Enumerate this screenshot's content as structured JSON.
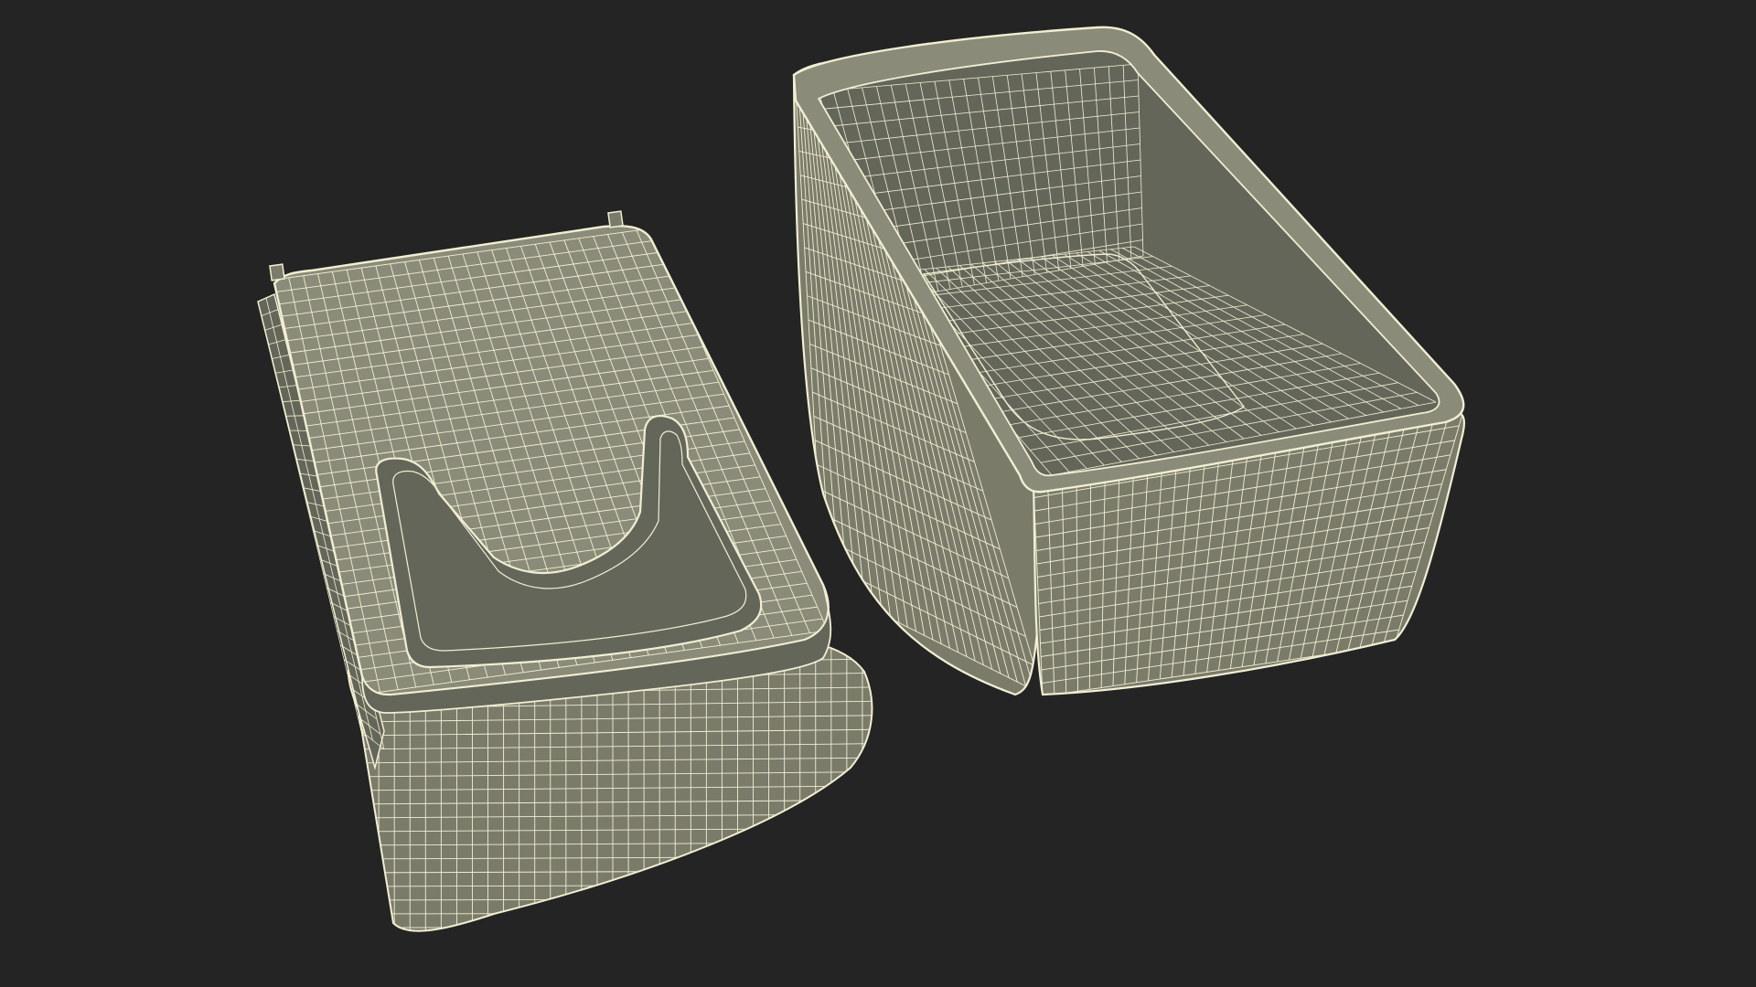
{
  "scene": {
    "background_color": "#242424",
    "surface_color": "#7b7b6a",
    "surface_shade_color": "#65665a",
    "surface_light_color": "#8a8b78",
    "wire_color": "#f1eed3",
    "objects": [
      {
        "name": "lid",
        "description_icon": "wireframe-lid"
      },
      {
        "name": "base-tub",
        "description_icon": "wireframe-tub"
      }
    ]
  }
}
